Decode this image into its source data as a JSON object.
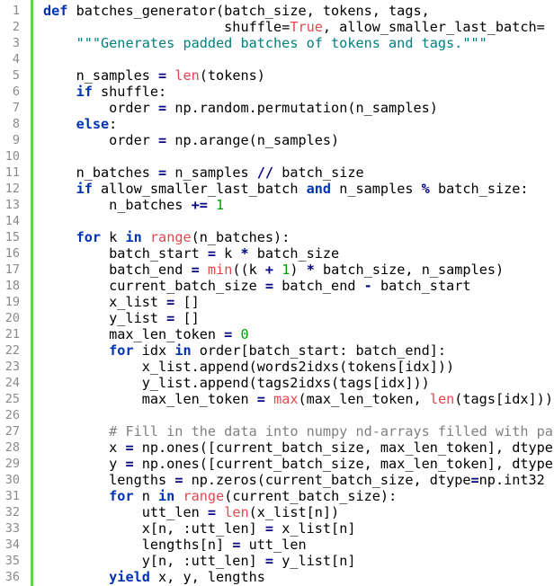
{
  "editor": {
    "colors": {
      "gutter_bar": "#6ccd5a",
      "keyword": "#0033b3",
      "builtin": "#e4474e",
      "number": "#00a000",
      "operator": "#000080",
      "string": "#008080",
      "comment": "#808080",
      "plain": "#000000",
      "line_number": "#8a8a8a"
    },
    "lines": [
      {
        "n": "1",
        "tokens": [
          {
            "t": "kw",
            "v": "def"
          },
          {
            "t": "pl",
            "v": " batches_generator(batch_size, tokens, tags,"
          }
        ]
      },
      {
        "n": "2",
        "tokens": [
          {
            "t": "pl",
            "v": "                      shuffle="
          },
          {
            "t": "bi",
            "v": "True"
          },
          {
            "t": "pl",
            "v": ", allow_smaller_last_batch="
          }
        ]
      },
      {
        "n": "3",
        "tokens": [
          {
            "t": "pl",
            "v": "    "
          },
          {
            "t": "st",
            "v": "\"\"\"Generates padded batches of tokens and tags.\"\"\""
          }
        ]
      },
      {
        "n": "4",
        "tokens": []
      },
      {
        "n": "5",
        "tokens": [
          {
            "t": "pl",
            "v": "    n_samples "
          },
          {
            "t": "op",
            "v": "="
          },
          {
            "t": "pl",
            "v": " "
          },
          {
            "t": "bi",
            "v": "len"
          },
          {
            "t": "pl",
            "v": "(tokens)"
          }
        ]
      },
      {
        "n": "6",
        "tokens": [
          {
            "t": "pl",
            "v": "    "
          },
          {
            "t": "kw",
            "v": "if"
          },
          {
            "t": "pl",
            "v": " shuffle:"
          }
        ]
      },
      {
        "n": "7",
        "tokens": [
          {
            "t": "pl",
            "v": "        order "
          },
          {
            "t": "op",
            "v": "="
          },
          {
            "t": "pl",
            "v": " np.random.permutation(n_samples)"
          }
        ]
      },
      {
        "n": "8",
        "tokens": [
          {
            "t": "pl",
            "v": "    "
          },
          {
            "t": "kw",
            "v": "else"
          },
          {
            "t": "pl",
            "v": ":"
          }
        ]
      },
      {
        "n": "9",
        "tokens": [
          {
            "t": "pl",
            "v": "        order "
          },
          {
            "t": "op",
            "v": "="
          },
          {
            "t": "pl",
            "v": " np.arange(n_samples)"
          }
        ]
      },
      {
        "n": "10",
        "tokens": []
      },
      {
        "n": "11",
        "tokens": [
          {
            "t": "pl",
            "v": "    n_batches "
          },
          {
            "t": "op",
            "v": "="
          },
          {
            "t": "pl",
            "v": " n_samples "
          },
          {
            "t": "op",
            "v": "//"
          },
          {
            "t": "pl",
            "v": " batch_size"
          }
        ]
      },
      {
        "n": "12",
        "tokens": [
          {
            "t": "pl",
            "v": "    "
          },
          {
            "t": "kw",
            "v": "if"
          },
          {
            "t": "pl",
            "v": " allow_smaller_last_batch "
          },
          {
            "t": "kw",
            "v": "and"
          },
          {
            "t": "pl",
            "v": " n_samples "
          },
          {
            "t": "op",
            "v": "%"
          },
          {
            "t": "pl",
            "v": " batch_size:"
          }
        ]
      },
      {
        "n": "13",
        "tokens": [
          {
            "t": "pl",
            "v": "        n_batches "
          },
          {
            "t": "op",
            "v": "+="
          },
          {
            "t": "pl",
            "v": " "
          },
          {
            "t": "nm",
            "v": "1"
          }
        ]
      },
      {
        "n": "14",
        "tokens": []
      },
      {
        "n": "15",
        "tokens": [
          {
            "t": "pl",
            "v": "    "
          },
          {
            "t": "kw",
            "v": "for"
          },
          {
            "t": "pl",
            "v": " k "
          },
          {
            "t": "kw",
            "v": "in"
          },
          {
            "t": "pl",
            "v": " "
          },
          {
            "t": "bi",
            "v": "range"
          },
          {
            "t": "pl",
            "v": "(n_batches):"
          }
        ]
      },
      {
        "n": "16",
        "tokens": [
          {
            "t": "pl",
            "v": "        batch_start "
          },
          {
            "t": "op",
            "v": "="
          },
          {
            "t": "pl",
            "v": " k "
          },
          {
            "t": "op",
            "v": "*"
          },
          {
            "t": "pl",
            "v": " batch_size"
          }
        ]
      },
      {
        "n": "17",
        "tokens": [
          {
            "t": "pl",
            "v": "        batch_end "
          },
          {
            "t": "op",
            "v": "="
          },
          {
            "t": "pl",
            "v": " "
          },
          {
            "t": "bi",
            "v": "min"
          },
          {
            "t": "pl",
            "v": "((k "
          },
          {
            "t": "op",
            "v": "+"
          },
          {
            "t": "pl",
            "v": " "
          },
          {
            "t": "nm",
            "v": "1"
          },
          {
            "t": "pl",
            "v": ") "
          },
          {
            "t": "op",
            "v": "*"
          },
          {
            "t": "pl",
            "v": " batch_size, n_samples)"
          }
        ]
      },
      {
        "n": "18",
        "tokens": [
          {
            "t": "pl",
            "v": "        current_batch_size "
          },
          {
            "t": "op",
            "v": "="
          },
          {
            "t": "pl",
            "v": " batch_end "
          },
          {
            "t": "op",
            "v": "-"
          },
          {
            "t": "pl",
            "v": " batch_start"
          }
        ]
      },
      {
        "n": "19",
        "tokens": [
          {
            "t": "pl",
            "v": "        x_list "
          },
          {
            "t": "op",
            "v": "="
          },
          {
            "t": "pl",
            "v": " []"
          }
        ]
      },
      {
        "n": "20",
        "tokens": [
          {
            "t": "pl",
            "v": "        y_list "
          },
          {
            "t": "op",
            "v": "="
          },
          {
            "t": "pl",
            "v": " []"
          }
        ]
      },
      {
        "n": "21",
        "tokens": [
          {
            "t": "pl",
            "v": "        max_len_token "
          },
          {
            "t": "op",
            "v": "="
          },
          {
            "t": "pl",
            "v": " "
          },
          {
            "t": "nm",
            "v": "0"
          }
        ]
      },
      {
        "n": "22",
        "tokens": [
          {
            "t": "pl",
            "v": "        "
          },
          {
            "t": "kw",
            "v": "for"
          },
          {
            "t": "pl",
            "v": " idx "
          },
          {
            "t": "kw",
            "v": "in"
          },
          {
            "t": "pl",
            "v": " order[batch_start: batch_end]:"
          }
        ]
      },
      {
        "n": "23",
        "tokens": [
          {
            "t": "pl",
            "v": "            x_list.append(words2idxs(tokens[idx]))"
          }
        ]
      },
      {
        "n": "24",
        "tokens": [
          {
            "t": "pl",
            "v": "            y_list.append(tags2idxs(tags[idx]))"
          }
        ]
      },
      {
        "n": "25",
        "tokens": [
          {
            "t": "pl",
            "v": "            max_len_token "
          },
          {
            "t": "op",
            "v": "="
          },
          {
            "t": "pl",
            "v": " "
          },
          {
            "t": "bi",
            "v": "max"
          },
          {
            "t": "pl",
            "v": "(max_len_token, "
          },
          {
            "t": "bi",
            "v": "len"
          },
          {
            "t": "pl",
            "v": "(tags[idx]))"
          }
        ]
      },
      {
        "n": "26",
        "tokens": []
      },
      {
        "n": "27",
        "tokens": [
          {
            "t": "pl",
            "v": "        "
          },
          {
            "t": "cm",
            "v": "# Fill in the data into numpy nd-arrays filled with pa"
          }
        ]
      },
      {
        "n": "28",
        "tokens": [
          {
            "t": "pl",
            "v": "        x "
          },
          {
            "t": "op",
            "v": "="
          },
          {
            "t": "pl",
            "v": " np.ones([current_batch_size, max_len_token], dtype"
          }
        ]
      },
      {
        "n": "29",
        "tokens": [
          {
            "t": "pl",
            "v": "        y "
          },
          {
            "t": "op",
            "v": "="
          },
          {
            "t": "pl",
            "v": " np.ones([current_batch_size, max_len_token], dtype"
          }
        ]
      },
      {
        "n": "30",
        "tokens": [
          {
            "t": "pl",
            "v": "        lengths "
          },
          {
            "t": "op",
            "v": "="
          },
          {
            "t": "pl",
            "v": " np.zeros(current_batch_size, dtype"
          },
          {
            "t": "op",
            "v": "="
          },
          {
            "t": "pl",
            "v": "np.int32"
          }
        ]
      },
      {
        "n": "31",
        "tokens": [
          {
            "t": "pl",
            "v": "        "
          },
          {
            "t": "kw",
            "v": "for"
          },
          {
            "t": "pl",
            "v": " n "
          },
          {
            "t": "kw",
            "v": "in"
          },
          {
            "t": "pl",
            "v": " "
          },
          {
            "t": "bi",
            "v": "range"
          },
          {
            "t": "pl",
            "v": "(current_batch_size):"
          }
        ]
      },
      {
        "n": "32",
        "tokens": [
          {
            "t": "pl",
            "v": "            utt_len "
          },
          {
            "t": "op",
            "v": "="
          },
          {
            "t": "pl",
            "v": " "
          },
          {
            "t": "bi",
            "v": "len"
          },
          {
            "t": "pl",
            "v": "(x_list[n])"
          }
        ]
      },
      {
        "n": "33",
        "tokens": [
          {
            "t": "pl",
            "v": "            x[n, :utt_len] "
          },
          {
            "t": "op",
            "v": "="
          },
          {
            "t": "pl",
            "v": " x_list[n]"
          }
        ]
      },
      {
        "n": "34",
        "tokens": [
          {
            "t": "pl",
            "v": "            lengths[n] "
          },
          {
            "t": "op",
            "v": "="
          },
          {
            "t": "pl",
            "v": " utt_len"
          }
        ]
      },
      {
        "n": "35",
        "tokens": [
          {
            "t": "pl",
            "v": "            y[n, :utt_len] "
          },
          {
            "t": "op",
            "v": "="
          },
          {
            "t": "pl",
            "v": " y_list[n]"
          }
        ]
      },
      {
        "n": "36",
        "tokens": [
          {
            "t": "pl",
            "v": "        "
          },
          {
            "t": "kw",
            "v": "yield"
          },
          {
            "t": "pl",
            "v": " x, y, lengths"
          }
        ]
      }
    ]
  }
}
